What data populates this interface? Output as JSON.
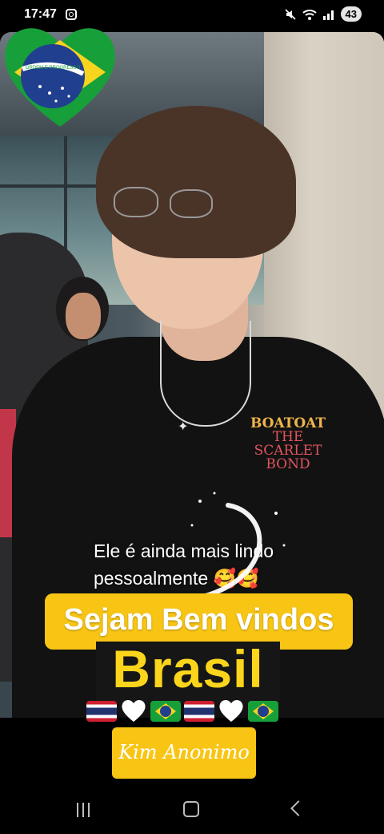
{
  "status_bar": {
    "time": "17:47",
    "battery_level": "43"
  },
  "post": {
    "caption_text": "Ele é ainda mais lindo pessoalmente 🥰🥰",
    "caption_line1": "Ele é ainda mais lindo",
    "caption_line2": "pessoalmente 🥰🥰",
    "welcome_banner": "Sejam Bem vindos",
    "country_title": "Brasil",
    "signature": "Kim Anonimo",
    "shirt_print": {
      "line1": "BOATOAT",
      "line2": "THE SCARLET",
      "line3": "BOND"
    },
    "flag_banner_text": "ORDEM E PROGRESSO"
  },
  "emoji_row": [
    "thailand-flag",
    "white-heart",
    "brazil-flag",
    "thailand-flag",
    "white-heart",
    "brazil-flag"
  ],
  "colors": {
    "banner_yellow": "#f8c514",
    "title_yellow": "#fad51c",
    "brazil_green": "#17a03a",
    "brazil_blue": "#213f8f"
  },
  "nav": {
    "recents": "recents-icon",
    "home": "home-icon",
    "back": "back-icon"
  }
}
